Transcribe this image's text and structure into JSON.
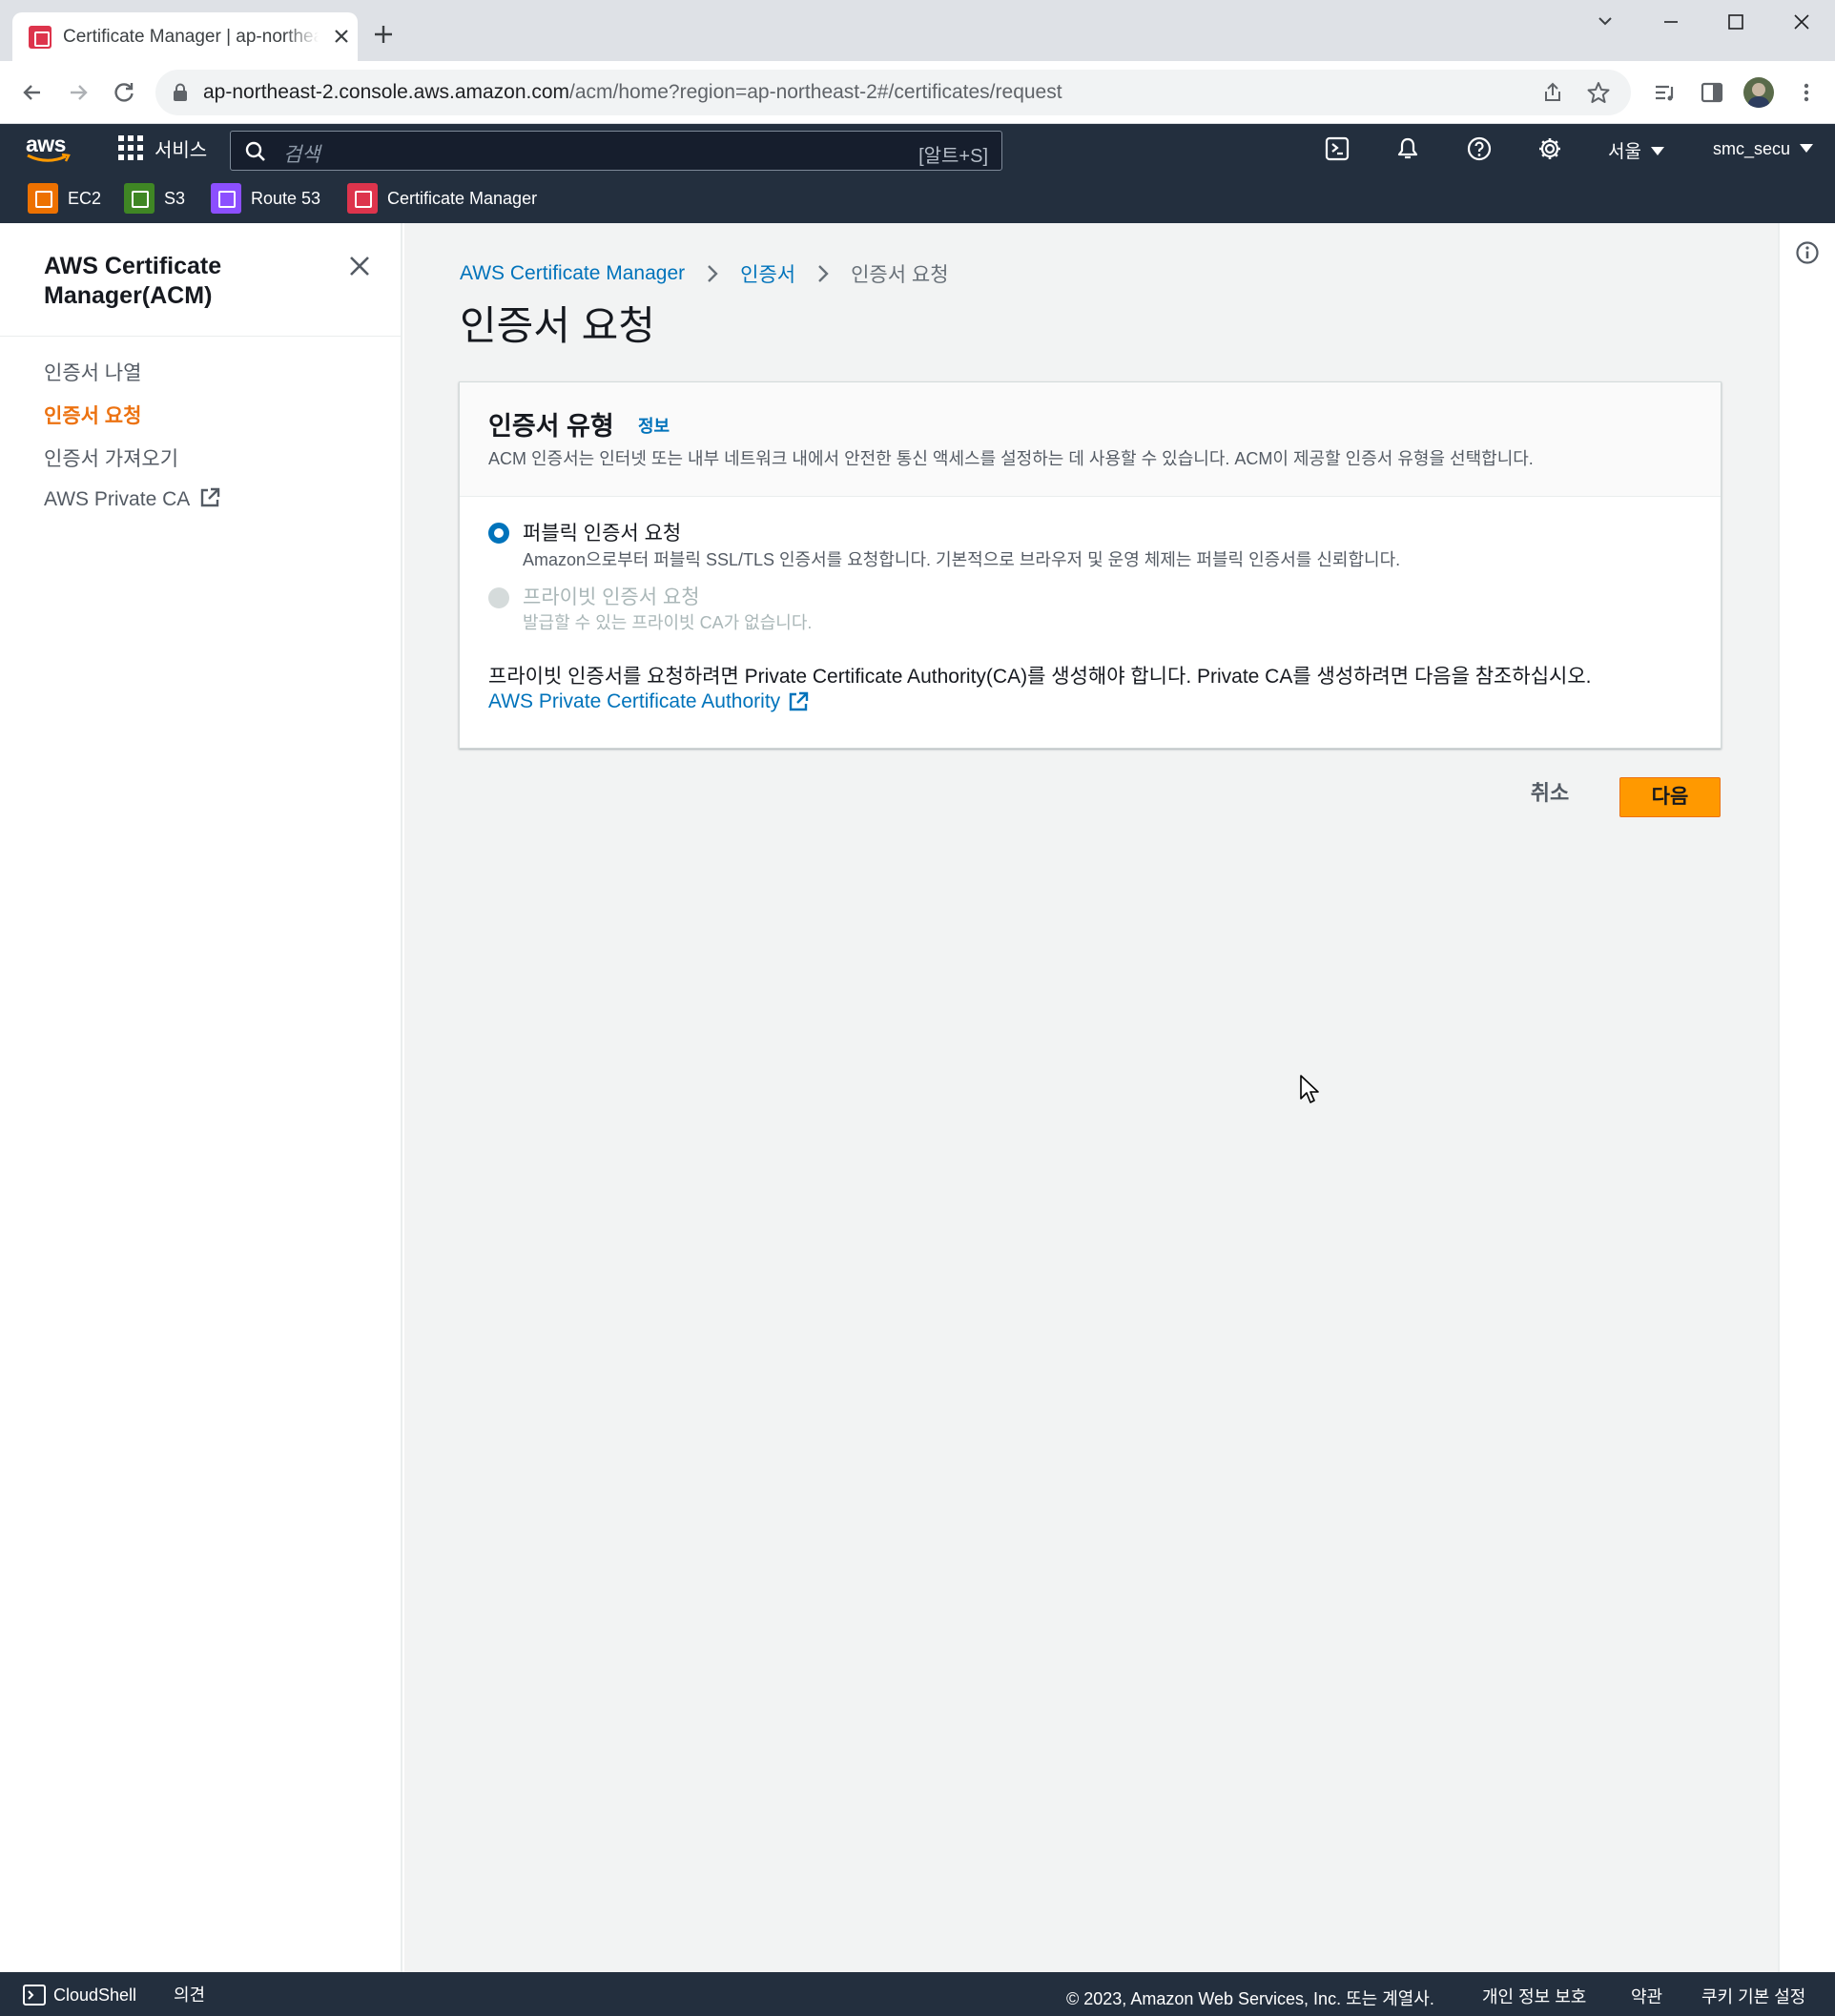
{
  "browser": {
    "tab_title": "Certificate Manager | ap-northeast-2",
    "url_host": "ap-northeast-2.console.aws.amazon.com",
    "url_path": "/acm/home?region=ap-northeast-2#/certificates/request"
  },
  "aws_nav": {
    "logo": "aws",
    "services_label": "서비스",
    "search_placeholder": "검색",
    "search_shortcut": "[알트+S]",
    "region": "서울",
    "account": "smc_secu"
  },
  "favorites": [
    {
      "label": "EC2",
      "icon": "ec2-icon",
      "color": "#ed7100"
    },
    {
      "label": "S3",
      "icon": "s3-icon",
      "color": "#3f8624"
    },
    {
      "label": "Route 53",
      "icon": "route53-icon",
      "color": "#8c4fff"
    },
    {
      "label": "Certificate Manager",
      "icon": "certificate-manager-icon",
      "color": "#dd344c"
    }
  ],
  "sidebar": {
    "title": "AWS Certificate Manager(ACM)",
    "items": [
      {
        "label": "인증서 나열",
        "active": false
      },
      {
        "label": "인증서 요청",
        "active": true
      },
      {
        "label": "인증서 가져오기",
        "active": false
      },
      {
        "label": "AWS Private CA",
        "active": false,
        "external": true
      }
    ]
  },
  "breadcrumb": [
    "AWS Certificate Manager",
    "인증서",
    "인증서 요청"
  ],
  "page_title": "인증서 요청",
  "panel": {
    "title": "인증서 유형",
    "info_link": "정보",
    "description": "ACM 인증서는 인터넷 또는 내부 네트워크 내에서 안전한 통신 액세스를 설정하는 데 사용할 수 있습니다. ACM이 제공할 인증서 유형을 선택합니다.",
    "options": [
      {
        "label": "퍼블릭 인증서 요청",
        "description": "Amazon으로부터 퍼블릭 SSL/TLS 인증서를 요청합니다. 기본적으로 브라우저 및 운영 체제는 퍼블릭 인증서를 신뢰합니다.",
        "selected": true,
        "disabled": false
      },
      {
        "label": "프라이빗 인증서 요청",
        "description": "발급할 수 있는 프라이빗 CA가 없습니다.",
        "selected": false,
        "disabled": true
      }
    ],
    "private_note": "프라이빗 인증서를 요청하려면 Private Certificate Authority(CA)를 생성해야 합니다. Private CA를 생성하려면 다음을 참조하십시오.",
    "private_ca_link": "AWS Private Certificate Authority"
  },
  "actions": {
    "cancel": "취소",
    "next": "다음"
  },
  "footer": {
    "cloudshell": "CloudShell",
    "feedback": "의견",
    "copyright": "© 2023, Amazon Web Services, Inc. 또는 계열사.",
    "links": [
      "개인 정보 보호",
      "약관",
      "쿠키 기본 설정"
    ]
  },
  "colors": {
    "accent": "#ff9900",
    "link": "#0073bb",
    "nav_bg": "#232f3e",
    "active_nav": "#ec7211"
  }
}
